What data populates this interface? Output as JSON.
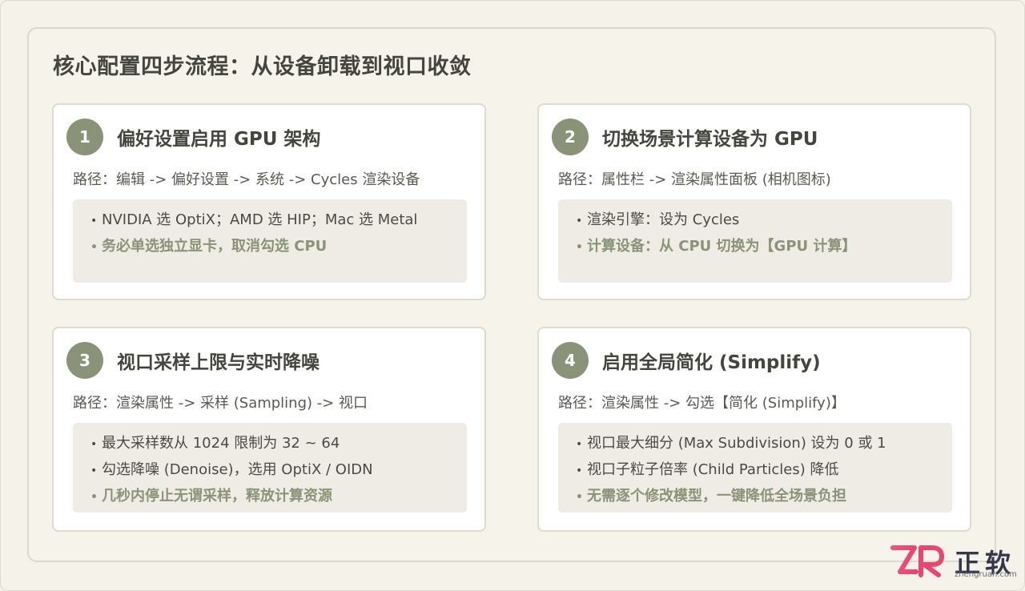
{
  "title": "核心配置四步流程：从设备卸载到视口收敛",
  "cards": [
    {
      "num": "1",
      "title": "偏好设置启用 GPU 架构",
      "path": "路径：编辑 -> 偏好设置 -> 系统 -> Cycles 渲染设备",
      "bullets": [
        {
          "text": "NVIDIA 选 OptiX；AMD 选 HIP；Mac 选 Metal",
          "accent": false
        },
        {
          "text": "务必单选独立显卡，取消勾选 CPU",
          "accent": true
        }
      ]
    },
    {
      "num": "2",
      "title": "切换场景计算设备为 GPU",
      "path": "路径：属性栏 -> 渲染属性面板 (相机图标)",
      "bullets": [
        {
          "text": "渲染引擎：设为 Cycles",
          "accent": false
        },
        {
          "text": "计算设备：从 CPU 切换为【GPU 计算】",
          "accent": true
        }
      ]
    },
    {
      "num": "3",
      "title": "视口采样上限与实时降噪",
      "path": "路径：渲染属性 -> 采样 (Sampling) -> 视口",
      "bullets": [
        {
          "text": "最大采样数从 1024 限制为 32 ~ 64",
          "accent": false
        },
        {
          "text": "勾选降噪 (Denoise)，选用 OptiX / OIDN",
          "accent": false
        },
        {
          "text": "几秒内停止无谓采样，释放计算资源",
          "accent": true
        }
      ]
    },
    {
      "num": "4",
      "title": "启用全局简化 (Simplify)",
      "path": "路径：渲染属性 -> 勾选【简化 (Simplify)】",
      "bullets": [
        {
          "text": "视口最大细分 (Max Subdivision) 设为 0 或 1",
          "accent": false
        },
        {
          "text": "视口子粒子倍率 (Child Particles) 降低",
          "accent": false
        },
        {
          "text": "无需逐个修改模型，一键降低全场景负担",
          "accent": true
        }
      ]
    }
  ],
  "logo": {
    "brand": "正软",
    "site": "zhengruan.com"
  },
  "colors": {
    "accent": "#8a9378",
    "background": "#f5f2ea",
    "card": "#ffffff",
    "box": "#efece5"
  }
}
